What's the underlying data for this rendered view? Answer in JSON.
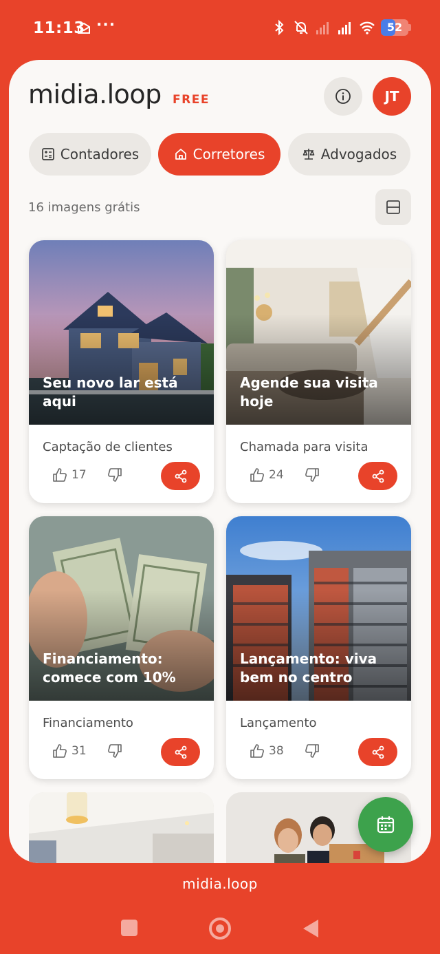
{
  "status_bar": {
    "time": "11:13",
    "dots": "···",
    "battery": "52"
  },
  "header": {
    "logo": "midia.loop",
    "plan": "FREE",
    "avatar_initials": "JT"
  },
  "tabs": [
    {
      "label": "Contadores",
      "icon": "calculator-icon",
      "active": false
    },
    {
      "label": "Corretores",
      "icon": "home-icon",
      "active": true
    },
    {
      "label": "Advogados",
      "icon": "scale-icon",
      "active": false
    }
  ],
  "gallery": {
    "count_text": "16 imagens grátis",
    "cards": [
      {
        "headline": "Seu novo lar está aqui",
        "category": "Captação de clientes",
        "likes": "17",
        "image": "house"
      },
      {
        "headline": "Agende sua visita hoje",
        "category": "Chamada para visita",
        "likes": "24",
        "image": "living-room"
      },
      {
        "headline": "Financiamento: comece com 10%",
        "category": "Financiamento",
        "likes": "31",
        "image": "money"
      },
      {
        "headline": "Lançamento: viva bem no centro",
        "category": "Lançamento",
        "likes": "38",
        "image": "buildings"
      }
    ]
  },
  "footer": {
    "brand": "midia.loop"
  },
  "colors": {
    "accent": "#E8432A",
    "fab": "#3DA24C",
    "background": "#FAF8F6"
  }
}
